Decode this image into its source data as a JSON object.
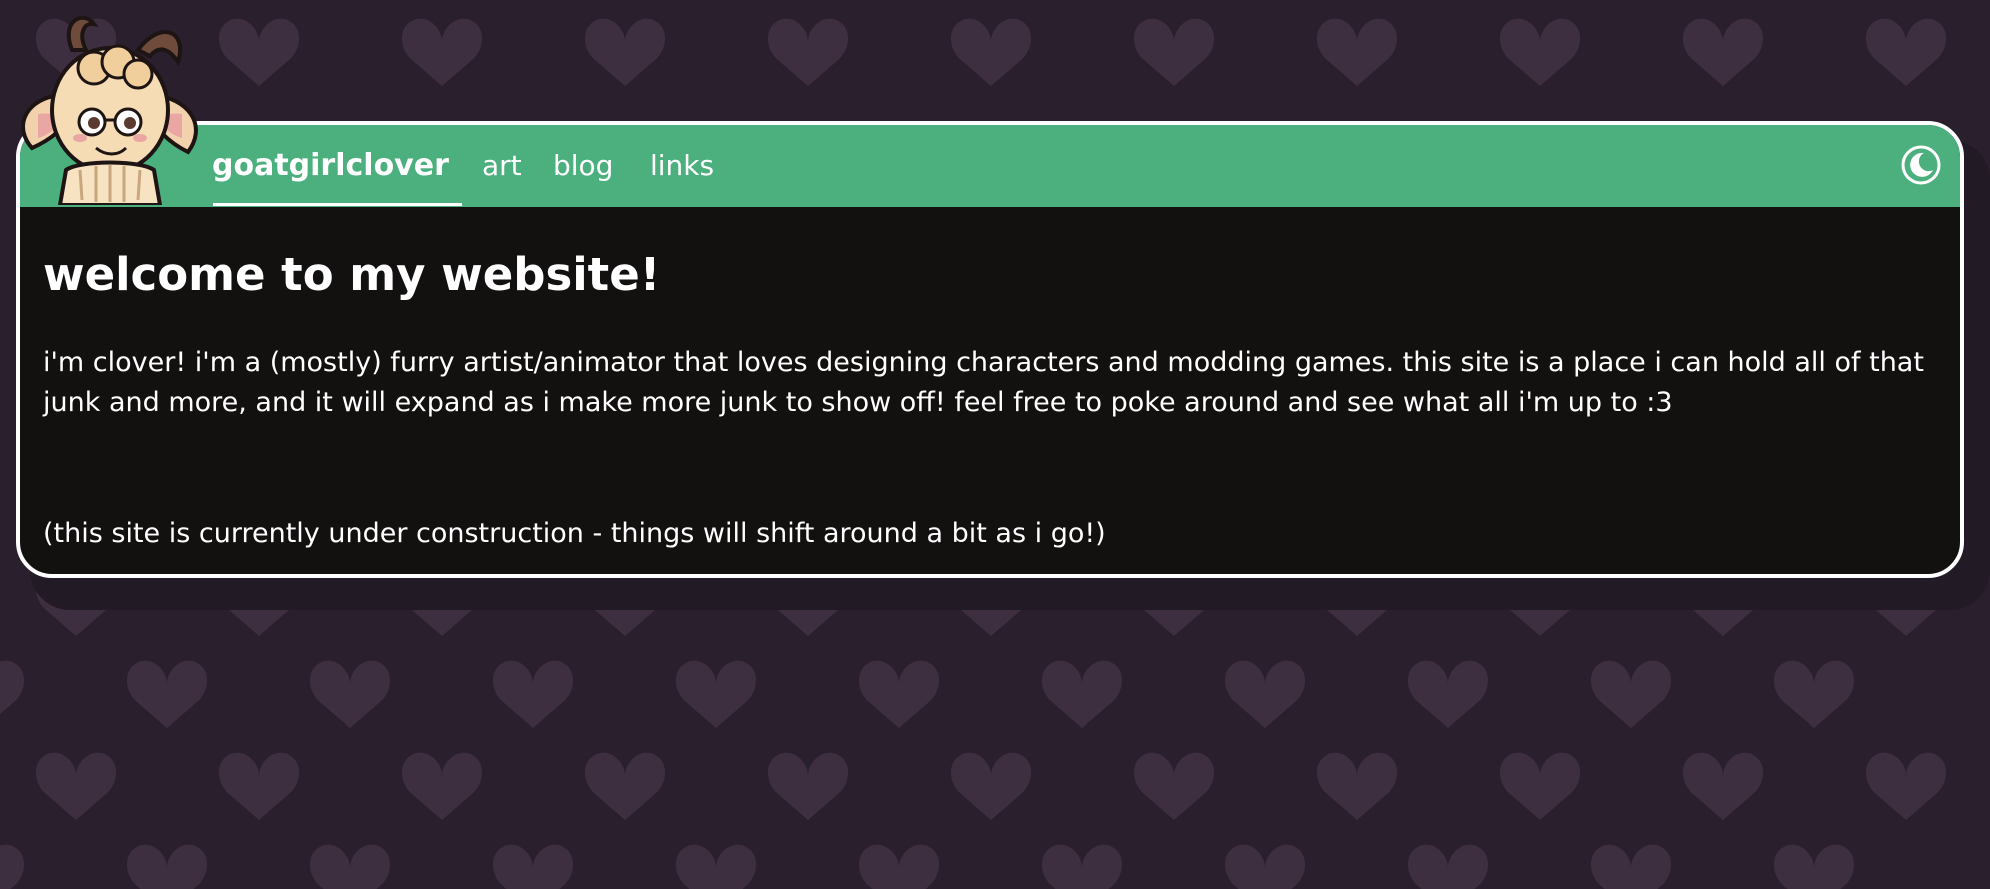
{
  "nav": {
    "brand": "goatgirlclover",
    "items": [
      {
        "label": "art"
      },
      {
        "label": "blog"
      },
      {
        "label": "links"
      }
    ],
    "theme_toggle_icon": "moon-icon"
  },
  "main": {
    "title": "welcome to my website!",
    "intro": "i'm clover! i'm a (mostly) furry artist/animator that loves designing characters and modding games. this site is a place i can hold all of that junk and more, and it will expand as i make more junk to show off! feel free to poke around and see what all i'm up to :3",
    "note": "(this site is currently under construction - things will shift around a bit as i go!)"
  },
  "colors": {
    "background": "#2a1f2c",
    "heart": "#3d2f40",
    "nav": "#4caf7e",
    "card": "#131010",
    "border": "#ffffff"
  },
  "mascot_icon": "goat-mascot-icon"
}
